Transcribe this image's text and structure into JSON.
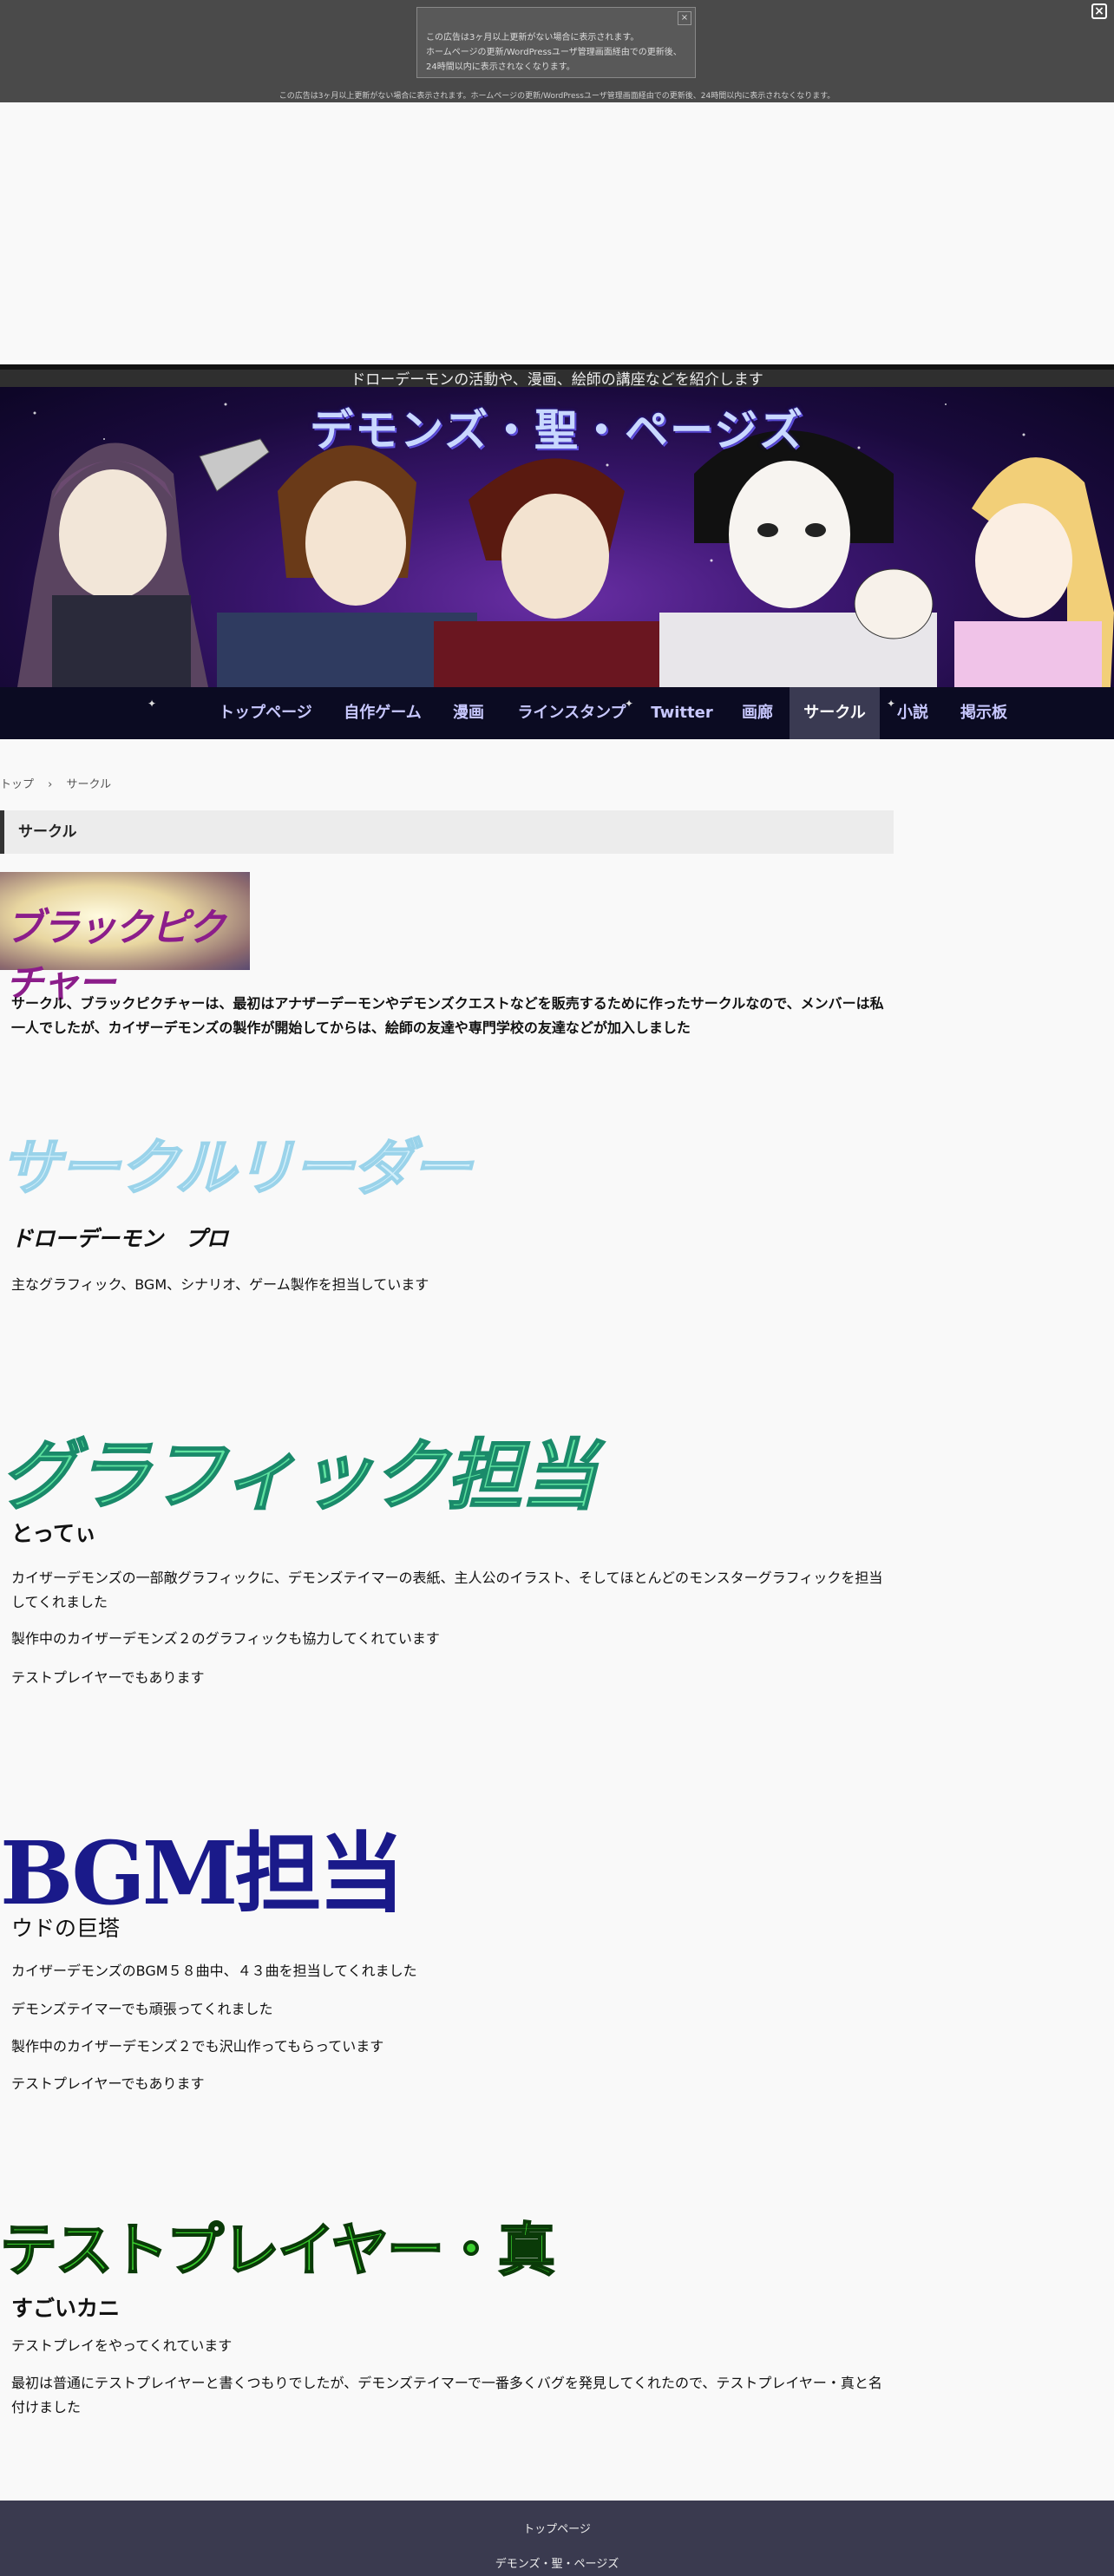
{
  "ad": {
    "box_lines": [
      "この広告は3ヶ月以上更新がない場合に表示されます。",
      "ホームページの更新/WordPressユーザ管理画面経由での更新後、",
      "24時間以内に表示されなくなります。"
    ],
    "close_glyph": "×",
    "footer_line": "この広告は3ヶ月以上更新がない場合に表示されます。ホームページの更新/WordPressユーザ管理画面経由での更新後、24時間以内に表示されなくなります。",
    "global_close_glyph": "×"
  },
  "header": {
    "tagline": "ドローデーモンの活動や、漫画、絵師の講座などを紹介します",
    "site_title": "デモンズ・聖・ページズ"
  },
  "nav": {
    "items": [
      {
        "label": "トップページ"
      },
      {
        "label": "自作ゲーム"
      },
      {
        "label": "漫画"
      },
      {
        "label": "ラインスタンプ"
      },
      {
        "label": "Twitter"
      },
      {
        "label": "画廊"
      },
      {
        "label": "サークル"
      },
      {
        "label": "小説"
      },
      {
        "label": "掲示板"
      }
    ],
    "active": "サークル"
  },
  "breadcrumb": {
    "home": "トップ",
    "separator": "›",
    "current": "サークル"
  },
  "page": {
    "heading": "サークル",
    "logo_text": "ブラックピクチャー",
    "intro": "サークル、ブラックピクチャーは、最初はアナザーデーモンやデモンズクエストなどを販売するために作ったサークルなので、メンバーは私一人でしたが、カイザーデモンズの製作が開始してからは、絵師の友達や専門学校の友達などが加入しました",
    "sections": [
      {
        "title_image_text": "サークルリーダー",
        "name": "ドローデーモン　プロ",
        "paragraphs": [
          "主なグラフィック、BGM、シナリオ、ゲーム製作を担当しています"
        ]
      },
      {
        "title_image_text": "グラフィック担当",
        "name": "とってぃ",
        "paragraphs": [
          "カイザーデモンズの一部敵グラフィックに、デモンズテイマーの表紙、主人公のイラスト、そしてほとんどのモンスターグラフィックを担当してくれました",
          "製作中のカイザーデモンズ２のグラフィックも協力してくれています",
          "テストプレイヤーでもあります"
        ]
      },
      {
        "title_image_text": "BGM担当",
        "name": "ウドの巨塔",
        "paragraphs": [
          "カイザーデモンズのBGM５８曲中、４３曲を担当してくれました",
          "デモンズテイマーでも頑張ってくれました",
          "製作中のカイザーデモンズ２でも沢山作ってもらっています",
          "テストプレイヤーでもあります"
        ]
      },
      {
        "title_image_text": "テストプレイヤー・真",
        "name": "すごいカニ",
        "paragraphs": [
          "テストプレイをやってくれています",
          "最初は普通にテストプレイヤーと書くつもりでしたが、デモンズテイマーで一番多くバグを発見してくれたので、テストプレイヤー・真と名付けました"
        ]
      }
    ]
  },
  "footer": {
    "link": "トップページ",
    "site_name": "デモンズ・聖・ページズ"
  },
  "colors": {
    "nav_bg": "#0b0b22",
    "nav_active": "#3a3a52",
    "footer_bg": "#3a3a4f",
    "ad_bg": "#4a4a4a"
  }
}
